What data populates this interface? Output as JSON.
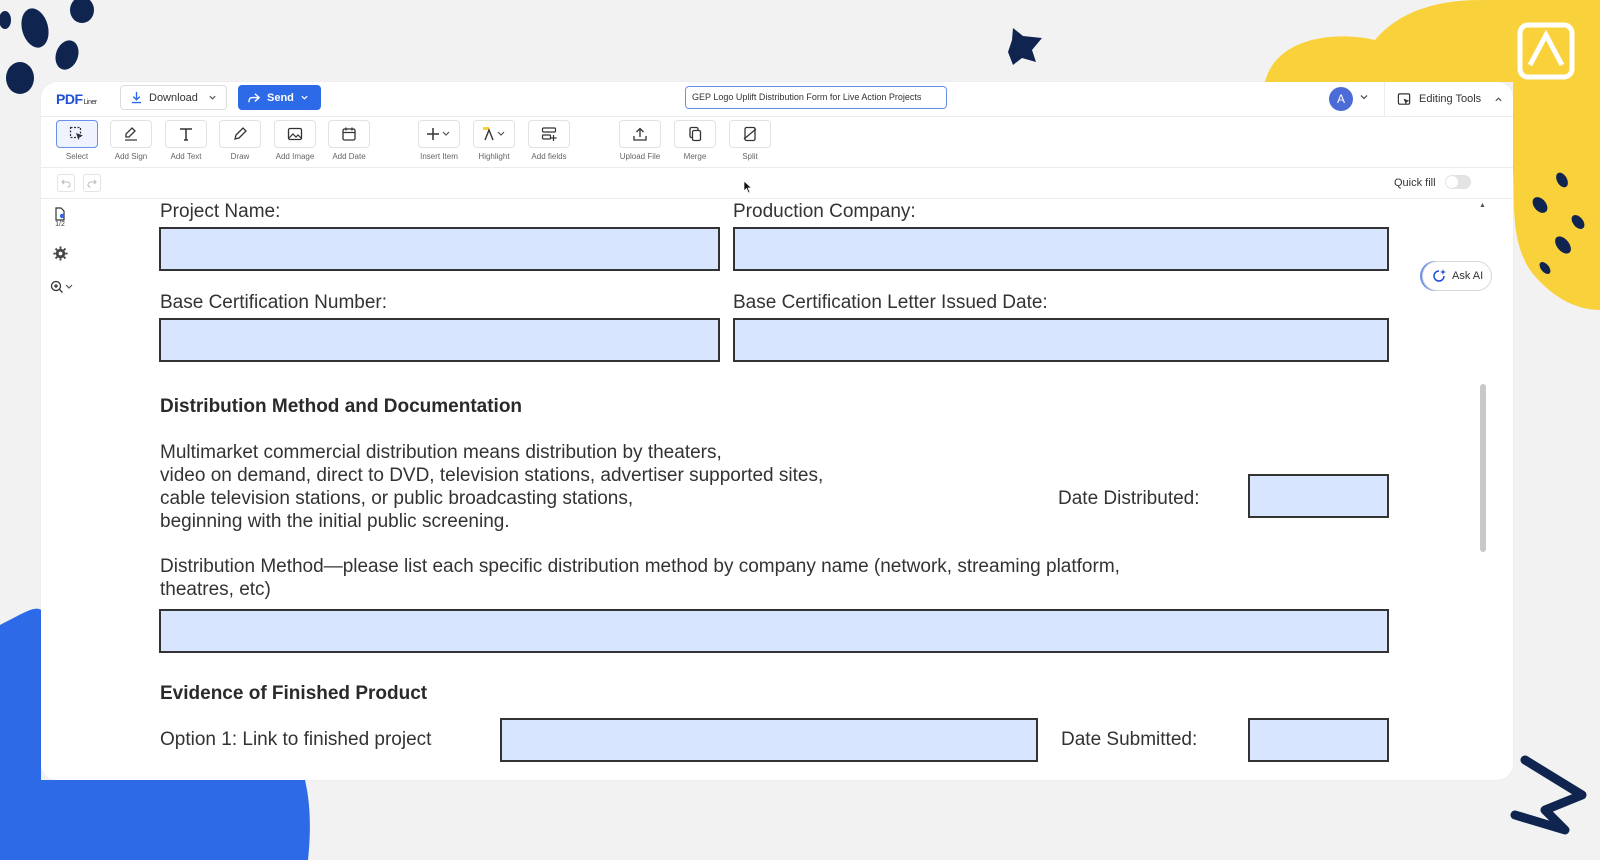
{
  "header": {
    "logo_text": "PDF",
    "logo_sub": "Liner",
    "download_label": "Download",
    "send_label": "Send",
    "document_name": "GEP Logo Uplift Distribution Form for Live Action Projects",
    "avatar_letter": "A",
    "editing_tools_label": "Editing Tools"
  },
  "toolbar": {
    "tools": [
      {
        "label": "Select",
        "icon": "select-icon"
      },
      {
        "label": "Add Sign",
        "icon": "signature-icon"
      },
      {
        "label": "Add Text",
        "icon": "text-icon"
      },
      {
        "label": "Draw",
        "icon": "pen-icon"
      },
      {
        "label": "Add Image",
        "icon": "image-icon"
      },
      {
        "label": "Add Date",
        "icon": "calendar-icon"
      },
      {
        "label": "Insert Item",
        "icon": "plus-icon"
      },
      {
        "label": "Highlight",
        "icon": "highlighter-icon"
      },
      {
        "label": "Add fields",
        "icon": "fields-icon"
      },
      {
        "label": "Upload File",
        "icon": "upload-icon"
      },
      {
        "label": "Merge",
        "icon": "merge-icon"
      },
      {
        "label": "Split",
        "icon": "split-icon"
      }
    ]
  },
  "subbar": {
    "quick_fill_label": "Quick fill",
    "quick_fill_on": false
  },
  "sidebar": {
    "page_count": "1/2"
  },
  "ask_ai_label": "Ask AI",
  "form": {
    "project_name_label": "Project Name:",
    "production_company_label": "Production Company:",
    "base_cert_number_label": "Base Certification Number:",
    "base_cert_date_label": "Base Certification Letter Issued Date:",
    "section_distribution": "Distribution Method and Documentation",
    "multimarket_lines": [
      "Multimarket commercial distribution means distribution by theaters,",
      "video on demand, direct to DVD, television stations, advertiser supported sites,",
      "cable television stations, or public broadcasting stations,",
      "beginning with the initial public screening."
    ],
    "date_distributed_label": "Date Distributed:",
    "distribution_method_lines": [
      "Distribution Method—please list each specific distribution method by company name (network, streaming platform,",
      "theatres, etc)"
    ],
    "section_evidence": "Evidence of Finished Product",
    "option1_label": "Option 1: Link to finished project",
    "date_submitted_label": "Date Submitted:"
  },
  "colors": {
    "accent": "#2d6ae8",
    "field_fill": "#d8e5ff",
    "deco_navy": "#0f2550",
    "deco_yellow": "#f9d23b",
    "deco_blue": "#2d6ae8"
  }
}
